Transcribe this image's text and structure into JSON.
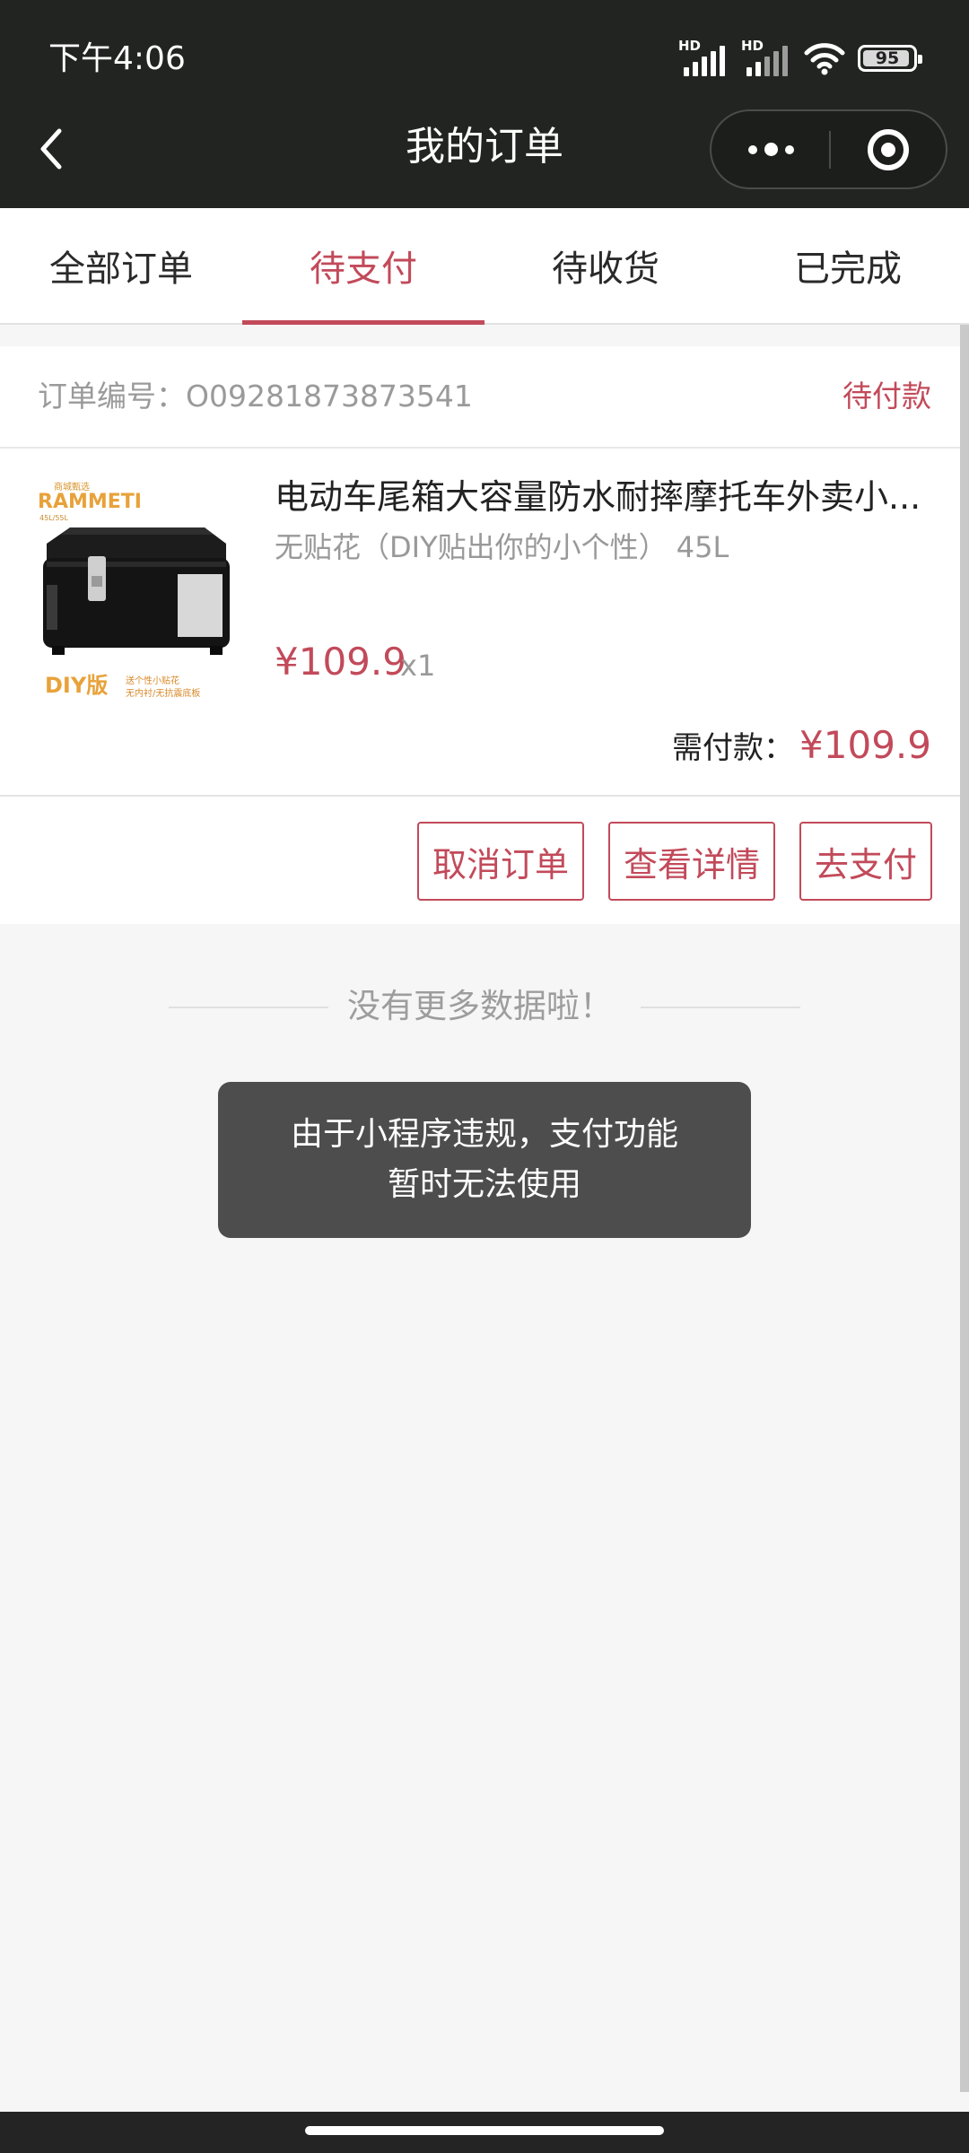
{
  "status_bar": {
    "time": "下午4:06",
    "network_1": "HD",
    "network_2": "HD",
    "signal_icon": "signal-bars-icon",
    "wifi_icon": "wifi-icon",
    "battery_level": "95",
    "battery_fraction": 0.95
  },
  "nav": {
    "back_icon": "chevron-left-icon",
    "title": "我的订单",
    "more_icon": "more-dots-icon",
    "close_icon": "target-close-icon"
  },
  "tabs": [
    {
      "label": "全部订单",
      "active": false
    },
    {
      "label": "待支付",
      "active": true
    },
    {
      "label": "待收货",
      "active": false
    },
    {
      "label": "已完成",
      "active": false
    }
  ],
  "order": {
    "number_label": "订单编号：",
    "number": "O09281873873541",
    "status": "待付款",
    "product": {
      "title": "电动车尾箱大容量防水耐摔摩托车外卖小...",
      "spec": "无贴花（DIY贴出你的小个性） 45L",
      "price": "¥109.9",
      "quantity": "x1",
      "image": {
        "brand_text": "RAMMETI",
        "top_label": "商城甄选",
        "size_note": "45L/55L",
        "diy_label": "DIY版",
        "sticker_line1": "送个性小贴花",
        "sticker_line2": "无内衬/无抗震底板"
      }
    },
    "pay_label": "需付款：",
    "pay_amount": "¥109.9",
    "buttons": {
      "cancel": "取消订单",
      "detail": "查看详情",
      "pay": "去支付"
    }
  },
  "no_more_text": "没有更多数据啦！",
  "toast": {
    "line1": "由于小程序违规，支付功能",
    "line2": "暂时无法使用"
  },
  "colors": {
    "accent": "#c24a5a",
    "top_bar": "#222422",
    "page_bg": "#f6f6f6",
    "toast_bg": "#4d4d4d"
  }
}
